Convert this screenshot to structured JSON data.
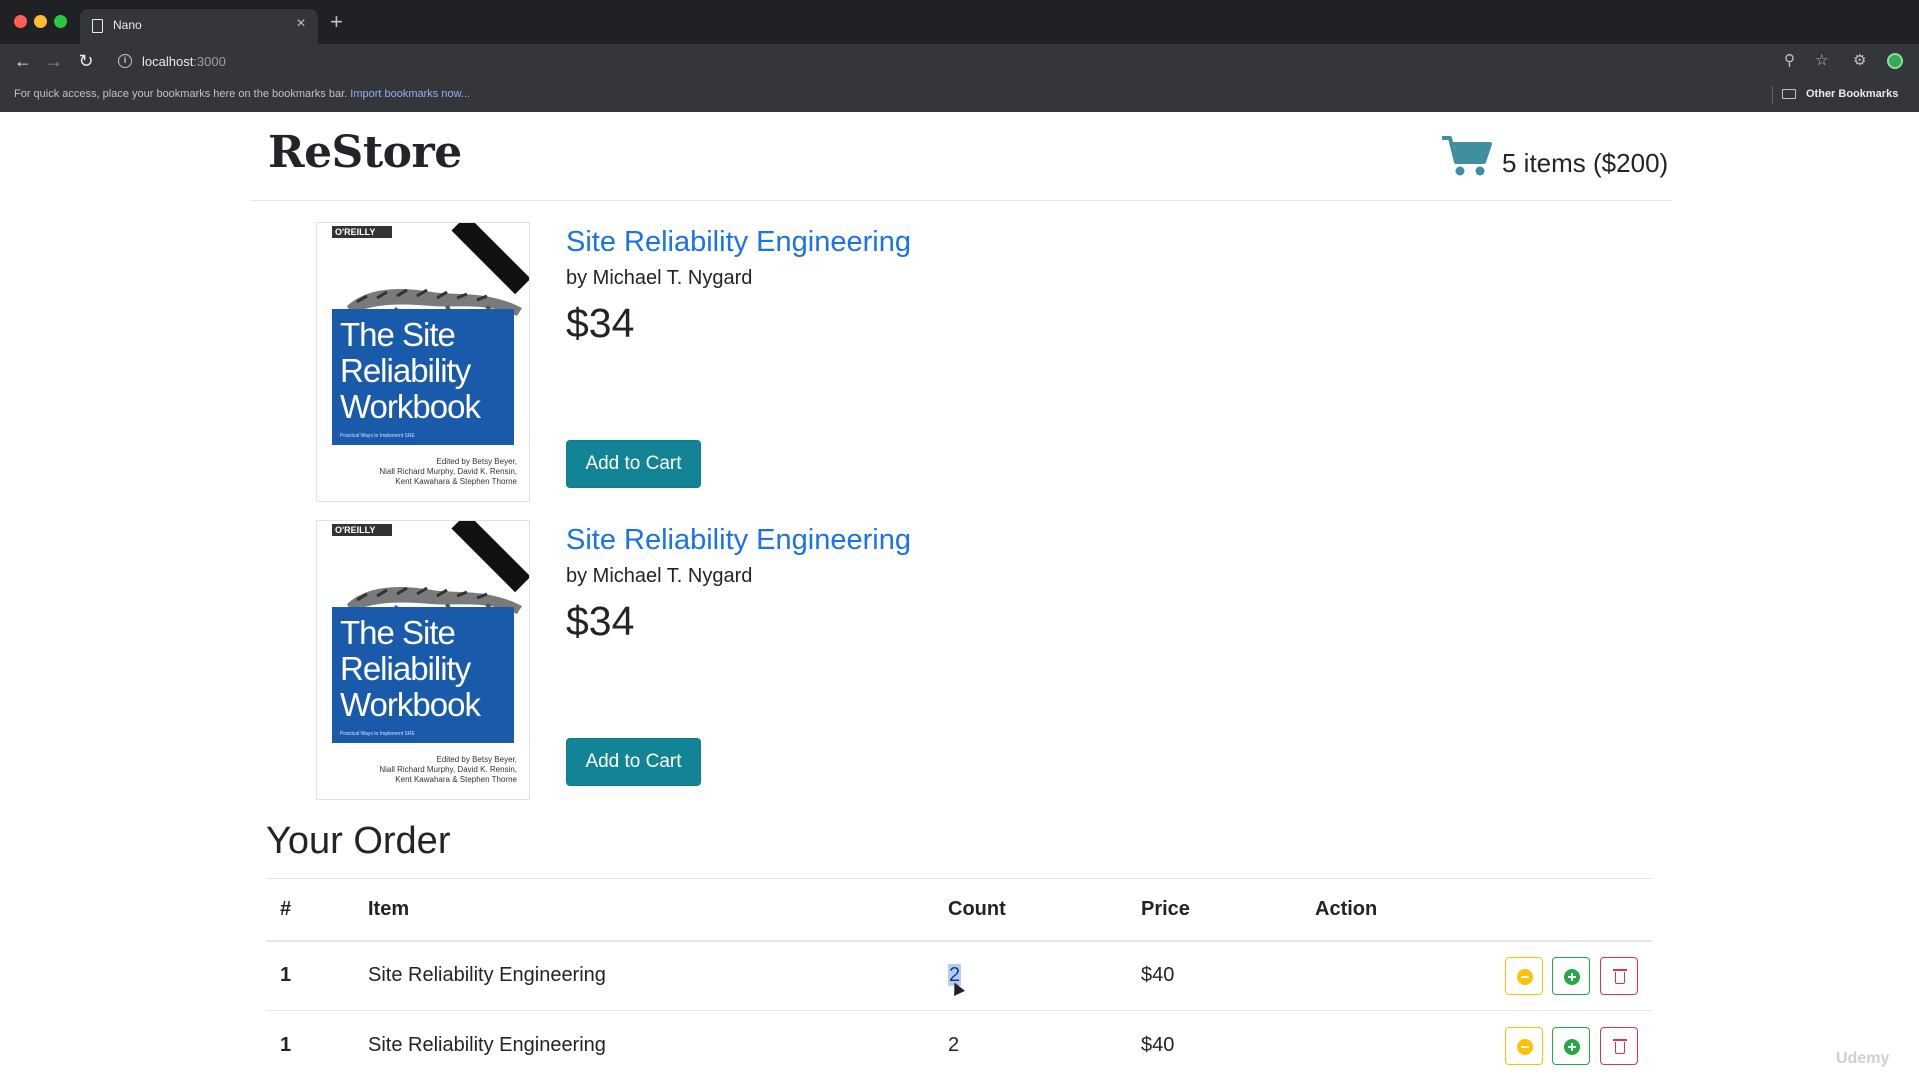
{
  "browser": {
    "tab_title": "Nano",
    "tab_close": "×",
    "new_tab": "+",
    "url": "localhost",
    "url_port": ":3000",
    "bookmarks_hint": "For quick access, place your bookmarks here on the bookmarks bar.",
    "bookmarks_import": "Import bookmarks now...",
    "other_bookmarks": "Other Bookmarks"
  },
  "header": {
    "brand": "ReStore",
    "cart_summary": "5 items ($200)",
    "cart_color": "#3f8fa0"
  },
  "books": [
    {
      "title": "Site Reliability Engineering",
      "author": "by Michael T. Nygard",
      "price": "$34",
      "add_label": "Add to Cart",
      "cover": {
        "publisher": "O'REILLY",
        "title_lines": [
          "The Site",
          "Reliability",
          "Workbook"
        ],
        "subtitle": "Practical Ways to Implement SRE",
        "credits": [
          "Edited by Betsy Beyer,",
          "Niall Richard Murphy, David K. Rensin,",
          "Kent Kawahara & Stephen Thorne"
        ]
      }
    },
    {
      "title": "Site Reliability Engineering",
      "author": "by Michael T. Nygard",
      "price": "$34",
      "add_label": "Add to Cart",
      "cover": {
        "publisher": "O'REILLY",
        "title_lines": [
          "The Site",
          "Reliability",
          "Workbook"
        ],
        "subtitle": "Practical Ways to Implement SRE",
        "credits": [
          "Edited by Betsy Beyer,",
          "Niall Richard Murphy, David K. Rensin,",
          "Kent Kawahara & Stephen Thorne"
        ]
      }
    }
  ],
  "order": {
    "title": "Your Order",
    "columns": [
      "#",
      "Item",
      "Count",
      "Price",
      "Action"
    ],
    "rows": [
      {
        "idx": "1",
        "item": "Site Reliability Engineering",
        "count": "2",
        "price": "$40"
      },
      {
        "idx": "1",
        "item": "Site Reliability Engineering",
        "count": "2",
        "price": "$40"
      }
    ]
  },
  "colors": {
    "accent_button": "#138496",
    "link": "#1a73e8",
    "warning": "#ffc107",
    "success": "#28a745",
    "danger": "#dc3545"
  },
  "watermark": "Udemy"
}
